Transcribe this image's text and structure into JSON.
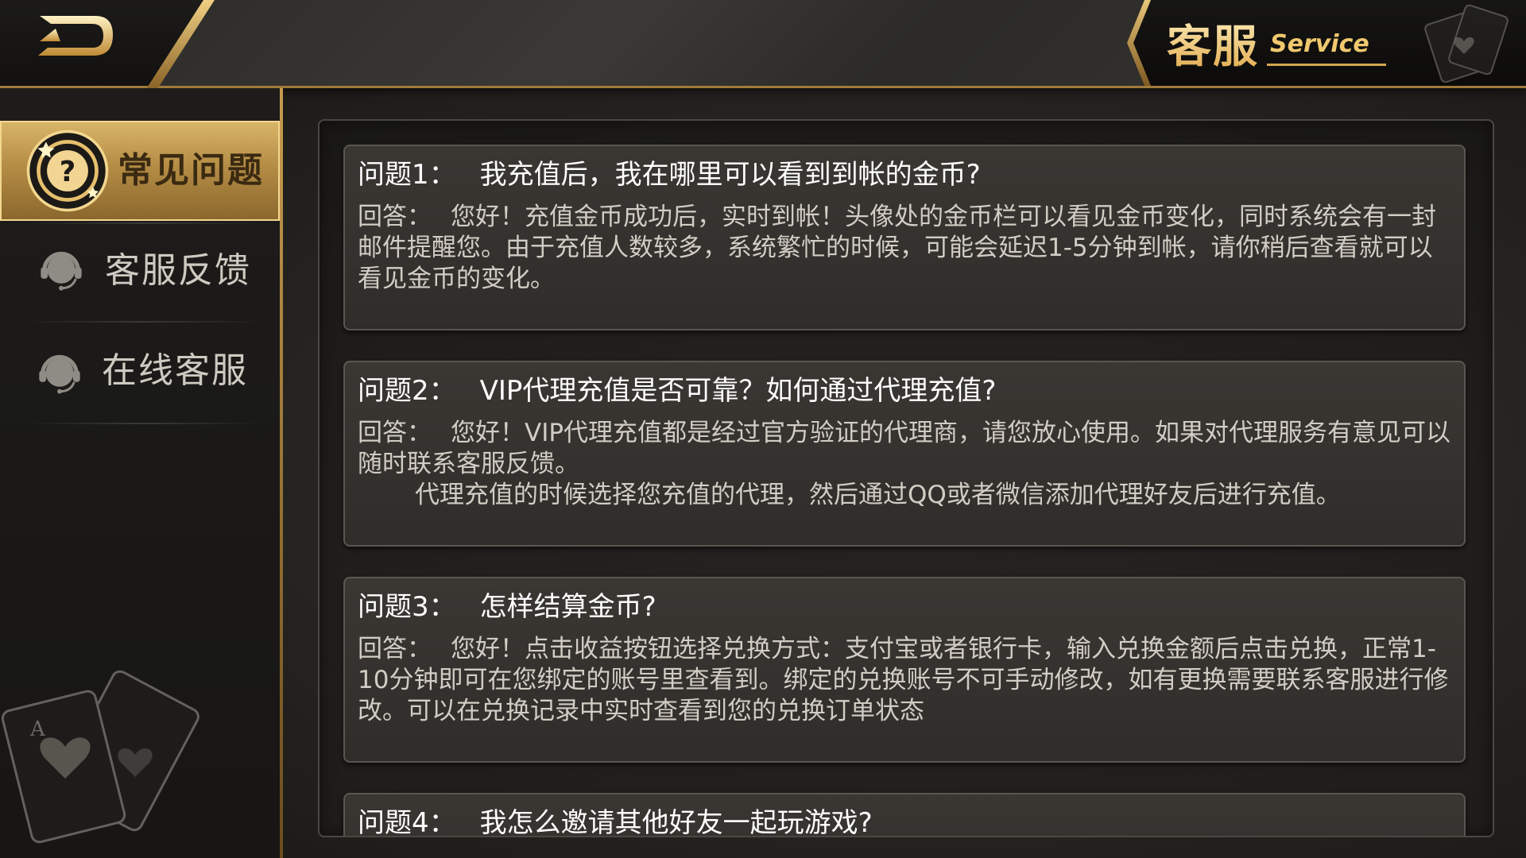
{
  "header": {
    "title_cn": "客服",
    "title_en": "Service",
    "back_icon": "back-arrow-icon"
  },
  "sidebar": {
    "items": [
      {
        "label": "常见问题",
        "icon": "question-icon",
        "active": true
      },
      {
        "label": "客服反馈",
        "icon": "headset-icon",
        "active": false
      },
      {
        "label": "在线客服",
        "icon": "headset-icon",
        "active": false
      }
    ]
  },
  "faq": [
    {
      "q_label": "问题1：",
      "question": "我充值后，我在哪里可以看到到帐的金币?",
      "a_label": "回答：",
      "answer": "您好！充值金币成功后，实时到帐！头像处的金币栏可以看见金币变化，同时系统会有一封邮件提醒您。由于充值人数较多，系统繁忙的时候，可能会延迟1-5分钟到帐，请你稍后查看就可以看见金币的变化。",
      "answer_extra": ""
    },
    {
      "q_label": "问题2：",
      "question": "VIP代理充值是否可靠？如何通过代理充值?",
      "a_label": "回答：",
      "answer": "您好！VIP代理充值都是经过官方验证的代理商，请您放心使用。如果对代理服务有意见可以随时联系客服反馈。",
      "answer_extra": "代理充值的时候选择您充值的代理，然后通过QQ或者微信添加代理好友后进行充值。"
    },
    {
      "q_label": "问题3：",
      "question": "怎样结算金币?",
      "a_label": "回答：",
      "answer": "您好！点击收益按钮选择兑换方式：支付宝或者银行卡，输入兑换金额后点击兑换，正常1-10分钟即可在您绑定的账号里查看到。绑定的兑换账号不可手动修改，如有更换需要联系客服进行修改。可以在兑换记录中实时查看到您的兑换订单状态",
      "answer_extra": ""
    },
    {
      "q_label": "问题4：",
      "question": "我怎么邀请其他好友一起玩游戏?",
      "a_label": "",
      "answer": "",
      "answer_extra": ""
    }
  ],
  "colors": {
    "gold": "#d9b66a",
    "panel_bg": "#2f2d2a",
    "text_primary": "#ffffff",
    "text_secondary": "#d2cdc4"
  }
}
